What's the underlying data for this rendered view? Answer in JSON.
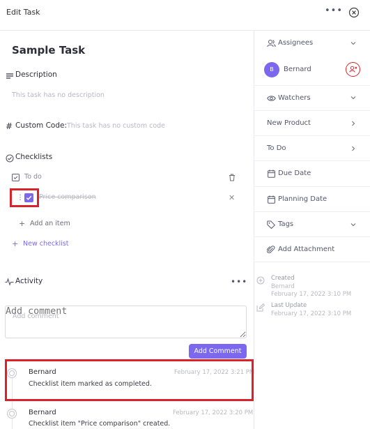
{
  "header": {
    "title": "Edit Task",
    "more_icon": "more-horizontal-icon",
    "close_icon": "close-circle-icon"
  },
  "task": {
    "title": "Sample Task"
  },
  "description": {
    "label": "Description",
    "placeholder": "This task has no description"
  },
  "custom_code": {
    "label": "Custom Code:",
    "placeholder": "This task has no custom code"
  },
  "checklists": {
    "label": "Checklists",
    "lists": [
      {
        "name": "To do",
        "items": [
          {
            "text": "Price comparison",
            "checked": true
          }
        ],
        "add_item_label": "Add an item"
      }
    ],
    "new_checklist_label": "New checklist"
  },
  "activity": {
    "label": "Activity",
    "comment_placeholder": "Add comment",
    "add_comment_label": "Add Comment",
    "entries": [
      {
        "user": "Bernard",
        "date": "February 17, 2022 3:21 PM",
        "text": "Checklist item marked as completed."
      },
      {
        "user": "Bernard",
        "date": "February 17, 2022 3:20 PM",
        "text": "Checklist item \"Price comparison\" created."
      }
    ]
  },
  "sidebar": {
    "assignees_label": "Assignees",
    "assignee": {
      "initial": "B",
      "name": "Bernard"
    },
    "watchers_label": "Watchers",
    "new_product_label": "New Product",
    "todo_label": "To Do",
    "due_date_label": "Due Date",
    "planning_date_label": "Planning Date",
    "tags_label": "Tags",
    "add_attachment_label": "Add Attachment",
    "created": {
      "label": "Created",
      "by": "Bernard",
      "date": "February 17, 2022 3:10 PM"
    },
    "last_update": {
      "label": "Last Update",
      "date": "February 17, 2022 3:10 PM"
    }
  },
  "colors": {
    "accent": "#7b68ee",
    "highlight": "#d9222a"
  }
}
